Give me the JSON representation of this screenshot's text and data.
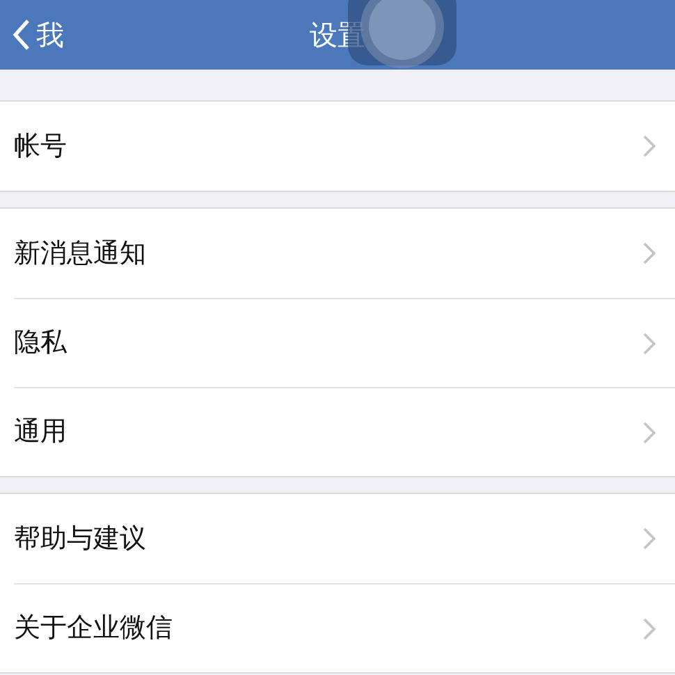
{
  "nav_bar": {
    "back_label": "我",
    "title": "设置"
  },
  "groups": [
    {
      "items": [
        {
          "label": "帐号"
        }
      ]
    },
    {
      "items": [
        {
          "label": "新消息通知"
        },
        {
          "label": "隐私"
        },
        {
          "label": "通用"
        }
      ]
    },
    {
      "items": [
        {
          "label": "帮助与建议"
        },
        {
          "label": "关于企业微信"
        }
      ]
    }
  ]
}
